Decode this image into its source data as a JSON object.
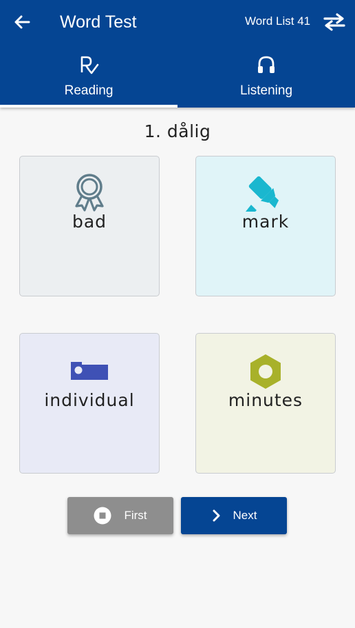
{
  "header": {
    "title": "Word Test",
    "list_label": "Word List 41",
    "back_icon": "arrow-left-icon",
    "swap_icon": "swap-arrows-icon",
    "bar_color": "#054593"
  },
  "tabs": [
    {
      "label": "Reading",
      "icon": "reading-check-icon",
      "selected": true
    },
    {
      "label": "Listening",
      "icon": "headphones-icon",
      "selected": false
    }
  ],
  "question": "1. dålig",
  "choices": [
    {
      "word": "bad",
      "icon": "award-ribbon-icon",
      "color": "#607d8b",
      "bg": "#eceff1"
    },
    {
      "word": "mark",
      "icon": "highlighter-icon",
      "color": "#1ab7cf",
      "bg": "#e0f4f8"
    },
    {
      "word": "individual",
      "icon": "bed-icon",
      "color": "#3f51b5",
      "bg": "#e8eaf6"
    },
    {
      "word": "minutes",
      "icon": "hex-nut-icon",
      "color": "#a8b12a",
      "bg": "#f2f3e4"
    }
  ],
  "buttons": {
    "first_label": "First",
    "first_icon": "stop-circle-icon",
    "next_label": "Next",
    "next_icon": "chevron-right-icon"
  }
}
